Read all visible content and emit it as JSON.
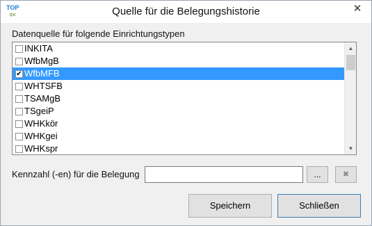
{
  "window": {
    "title": "Quelle für die Belegungshistorie",
    "app_icon": {
      "top": "TOP",
      "sub": "qw"
    },
    "close_glyph": "✕"
  },
  "list": {
    "label": "Datenquelle für folgende Einrichtungstypen",
    "items": [
      {
        "label": "INKITA",
        "checked": false,
        "selected": false
      },
      {
        "label": "WfbMgB",
        "checked": false,
        "selected": false
      },
      {
        "label": "WfbMFB",
        "checked": true,
        "selected": true
      },
      {
        "label": "WHTSFB",
        "checked": false,
        "selected": false
      },
      {
        "label": "TSAMgB",
        "checked": false,
        "selected": false
      },
      {
        "label": "TSgeiP",
        "checked": false,
        "selected": false
      },
      {
        "label": "WHKkör",
        "checked": false,
        "selected": false
      },
      {
        "label": "WHKgei",
        "checked": false,
        "selected": false
      },
      {
        "label": "WHKspr",
        "checked": false,
        "selected": false
      }
    ],
    "scroll_up_glyph": "▲",
    "scroll_down_glyph": "▼"
  },
  "kennzahl": {
    "label": "Kennzahl (-en) für die Belegung",
    "value": "",
    "browse_label": "...",
    "clear_glyph": "✖"
  },
  "buttons": {
    "save": "Speichern",
    "close": "Schließen"
  },
  "colors": {
    "selection": "#3399ff",
    "dialog_bg": "#f0f0f0",
    "button_bg": "#e1e1e1",
    "default_button_border": "#3c7fb1"
  },
  "icons": {
    "app": "topqw-logo-icon",
    "close": "close-icon",
    "scroll_up": "chevron-up-icon",
    "scroll_down": "chevron-down-icon",
    "clear": "clear-x-icon"
  }
}
